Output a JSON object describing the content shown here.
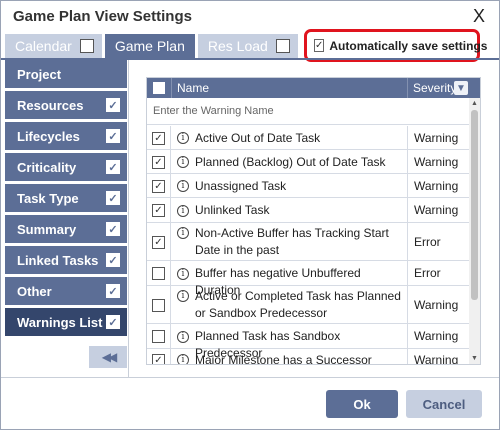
{
  "dialog": {
    "title": "Game Plan View Settings",
    "close_glyph": "X"
  },
  "tabs": [
    {
      "label": "Calendar",
      "checked": false,
      "active": false
    },
    {
      "label": "Game Plan",
      "active": true
    },
    {
      "label": "Res Load",
      "checked": false,
      "active": false
    }
  ],
  "autosave": {
    "label": "Automatically save settings",
    "checked": true
  },
  "sidebar": {
    "items": [
      {
        "label": "Project",
        "checked": null
      },
      {
        "label": "Resources",
        "checked": true
      },
      {
        "label": "Lifecycles",
        "checked": true
      },
      {
        "label": "Criticality",
        "checked": true
      },
      {
        "label": "Task Type",
        "checked": true
      },
      {
        "label": "Summary",
        "checked": true
      },
      {
        "label": "Linked Tasks",
        "checked": true
      },
      {
        "label": "Other",
        "checked": true
      },
      {
        "label": "Warnings List",
        "checked": true,
        "selected": true
      }
    ],
    "collapse_glyph": "◀◀"
  },
  "grid": {
    "columns": {
      "name": "Name",
      "severity": "Severity"
    },
    "search_placeholder": "Enter the Warning Name",
    "rows": [
      {
        "checked": true,
        "name": "Active Out of Date Task",
        "severity": "Warning"
      },
      {
        "checked": true,
        "name": "Planned (Backlog) Out of Date Task",
        "severity": "Warning"
      },
      {
        "checked": true,
        "name": "Unassigned Task",
        "severity": "Warning"
      },
      {
        "checked": true,
        "name": "Unlinked Task",
        "severity": "Warning"
      },
      {
        "checked": true,
        "name": "Non-Active Buffer has Tracking Start Date in the past",
        "severity": "Error"
      },
      {
        "checked": false,
        "name": "Buffer has negative Unbuffered Duration",
        "severity": "Error"
      },
      {
        "checked": false,
        "name": "Active or Completed Task has Planned or Sandbox Predecessor",
        "severity": "Warning"
      },
      {
        "checked": false,
        "name": "Planned Task has Sandbox Predecessor",
        "severity": "Warning"
      },
      {
        "checked": true,
        "name": "Major Milestone has a Successor",
        "severity": "Warning"
      }
    ]
  },
  "buttons": {
    "ok": "Ok",
    "cancel": "Cancel"
  },
  "colors": {
    "accent": "#5c6e96",
    "accent_dark": "#34466c",
    "highlight": "#e0141e",
    "light": "#c6cfe0"
  }
}
